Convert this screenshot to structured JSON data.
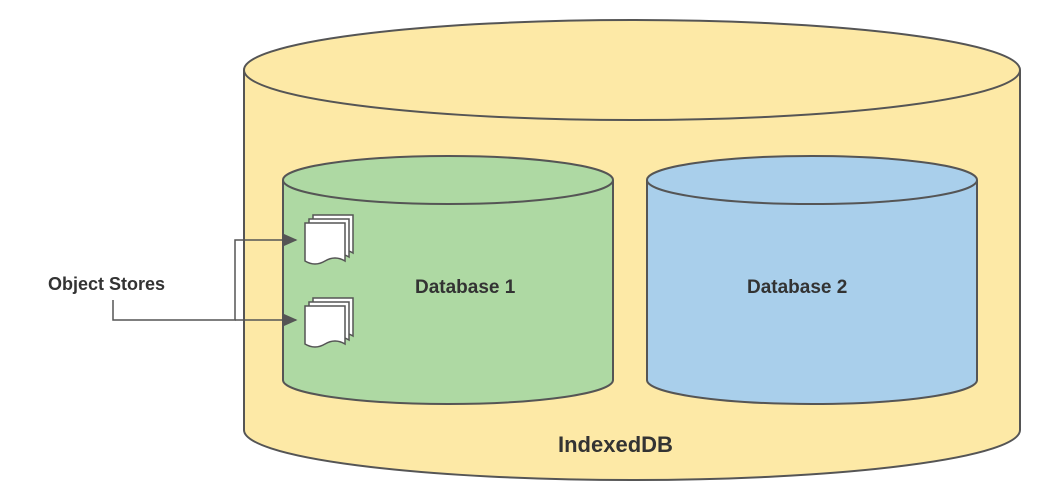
{
  "diagram": {
    "title": "IndexedDB",
    "object_stores_label": "Object Stores",
    "databases": [
      {
        "name": "Database 1"
      },
      {
        "name": "Database 2"
      }
    ],
    "colors": {
      "outer_fill": "#fde9a6",
      "db1_fill": "#aed9a3",
      "db2_fill": "#a9cfeb",
      "stroke": "#555555",
      "doc_fill": "#ffffff"
    }
  }
}
